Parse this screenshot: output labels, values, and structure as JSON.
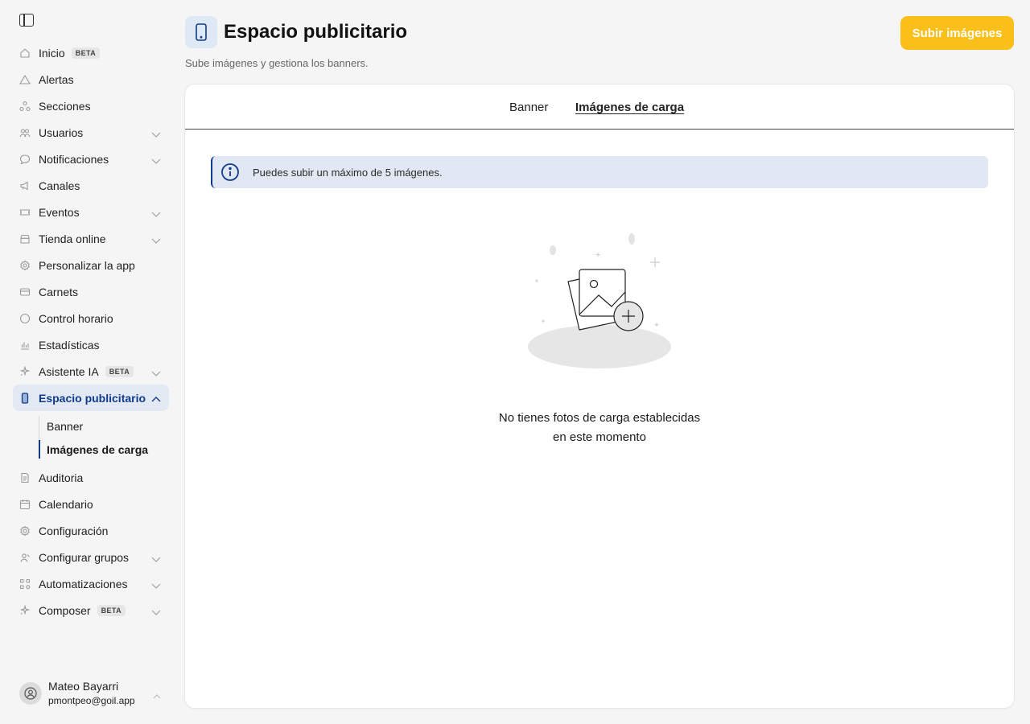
{
  "sidebar": {
    "items": [
      {
        "label": "Inicio",
        "icon": "home-icon",
        "badge": "BETA",
        "chevron": false
      },
      {
        "label": "Alertas",
        "icon": "alert-triangle-icon",
        "badge": "",
        "chevron": false
      },
      {
        "label": "Secciones",
        "icon": "sections-icon",
        "badge": "",
        "chevron": false
      },
      {
        "label": "Usuarios",
        "icon": "users-icon",
        "badge": "",
        "chevron": true
      },
      {
        "label": "Notificaciones",
        "icon": "chat-bubble-icon",
        "badge": "",
        "chevron": true
      },
      {
        "label": "Canales",
        "icon": "megaphone-icon",
        "badge": "",
        "chevron": false
      },
      {
        "label": "Eventos",
        "icon": "ticket-icon",
        "badge": "",
        "chevron": true
      },
      {
        "label": "Tienda online",
        "icon": "store-icon",
        "badge": "",
        "chevron": true
      },
      {
        "label": "Personalizar la app",
        "icon": "gear-icon",
        "badge": "",
        "chevron": false
      },
      {
        "label": "Carnets",
        "icon": "card-icon",
        "badge": "",
        "chevron": false
      },
      {
        "label": "Control horario",
        "icon": "clock-icon",
        "badge": "",
        "chevron": false
      },
      {
        "label": "Estadísticas",
        "icon": "bar-chart-icon",
        "badge": "",
        "chevron": false
      },
      {
        "label": "Asistente IA",
        "icon": "sparkle-icon",
        "badge": "BETA",
        "chevron": true
      }
    ],
    "active": {
      "label": "Espacio publicitario",
      "icon": "phone-icon"
    },
    "sub_items": [
      {
        "label": "Banner",
        "active": false
      },
      {
        "label": "Imágenes de carga",
        "active": true
      }
    ],
    "items_after": [
      {
        "label": "Auditoria",
        "icon": "document-icon",
        "badge": "",
        "chevron": false
      },
      {
        "label": "Calendario",
        "icon": "calendar-icon",
        "badge": "",
        "chevron": false
      },
      {
        "label": "Configuración",
        "icon": "gear-icon",
        "badge": "",
        "chevron": false
      },
      {
        "label": "Configurar grupos",
        "icon": "user-group-icon",
        "badge": "",
        "chevron": true
      },
      {
        "label": "Automatizaciones",
        "icon": "workflow-icon",
        "badge": "",
        "chevron": true
      },
      {
        "label": "Composer",
        "icon": "sparkle-icon",
        "badge": "BETA",
        "chevron": true
      }
    ],
    "user": {
      "name": "Mateo Bayarri",
      "email": "pmontpeo@goil.app"
    }
  },
  "header": {
    "title": "Espacio publicitario",
    "subtitle": "Sube imágenes y gestiona los banners.",
    "upload_button": "Subir imágenes"
  },
  "tabs": [
    {
      "label": "Banner",
      "active": false
    },
    {
      "label": "Imágenes de carga",
      "active": true
    }
  ],
  "info_banner": "Puedes subir un máximo de 5 imágenes.",
  "empty_state": {
    "line1": "No tienes fotos de carga establecidas",
    "line2": "en este momento"
  },
  "colors": {
    "accent": "#0f3b8a",
    "button": "#fbbf1a",
    "active_bg": "#e3e9f3",
    "info_bg": "#e1e8f3"
  }
}
